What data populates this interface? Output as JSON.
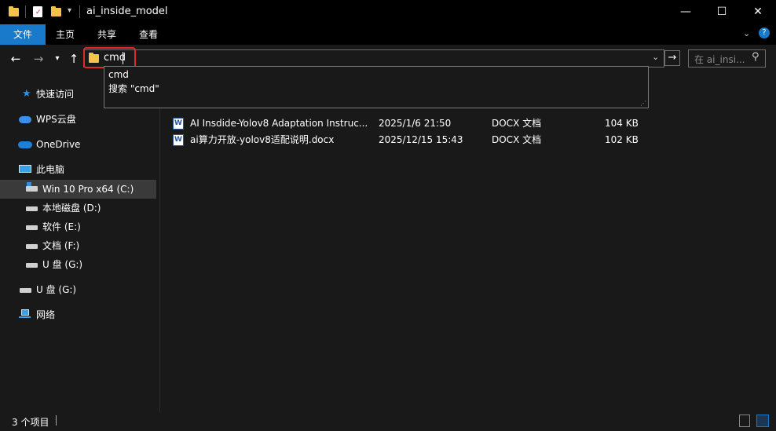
{
  "window": {
    "title": "ai_inside_model",
    "minimize_glyph": "—",
    "maximize_glyph": "☐",
    "close_glyph": "✕"
  },
  "ribbon": {
    "tabs": [
      {
        "label": "文件",
        "active": true
      },
      {
        "label": "主页"
      },
      {
        "label": "共享"
      },
      {
        "label": "查看"
      }
    ],
    "accent": "#1979ca"
  },
  "address": {
    "value": "cmd",
    "search_placeholder": "在 ai_insi...",
    "suggestions": [
      "cmd",
      "搜索 \"cmd\""
    ]
  },
  "sidebar": {
    "items": [
      {
        "label": "快速访问",
        "icon": "star-icon"
      },
      {
        "label": "WPS云盘",
        "icon": "cloud-icon"
      },
      {
        "label": "OneDrive",
        "icon": "onedrive-icon"
      },
      {
        "label": "此电脑",
        "icon": "computer-icon"
      },
      {
        "label": "Win 10 Pro x64 (C:)",
        "icon": "system-drive-icon",
        "selected": true
      },
      {
        "label": "本地磁盘 (D:)",
        "icon": "drive-icon"
      },
      {
        "label": "软件 (E:)",
        "icon": "drive-icon"
      },
      {
        "label": "文档 (F:)",
        "icon": "drive-icon"
      },
      {
        "label": "U 盘 (G:)",
        "icon": "drive-icon"
      },
      {
        "label": "U 盘 (G:)",
        "icon": "usb-drive-icon"
      },
      {
        "label": "网络",
        "icon": "network-icon"
      }
    ]
  },
  "files": [
    {
      "name": "AI Insdide-Yolov8 Adaptation Instruc...",
      "date": "2025/1/6 21:50",
      "type": "DOCX 文档",
      "size": "104 KB"
    },
    {
      "name": "ai算力开放-yolov8适配说明.docx",
      "date": "2025/12/15 15:43",
      "type": "DOCX 文档",
      "size": "102 KB"
    }
  ],
  "status": {
    "count": "3 个项目"
  },
  "colors": {
    "highlight_border": "#e02b2b",
    "folder": "#f3c34b"
  }
}
